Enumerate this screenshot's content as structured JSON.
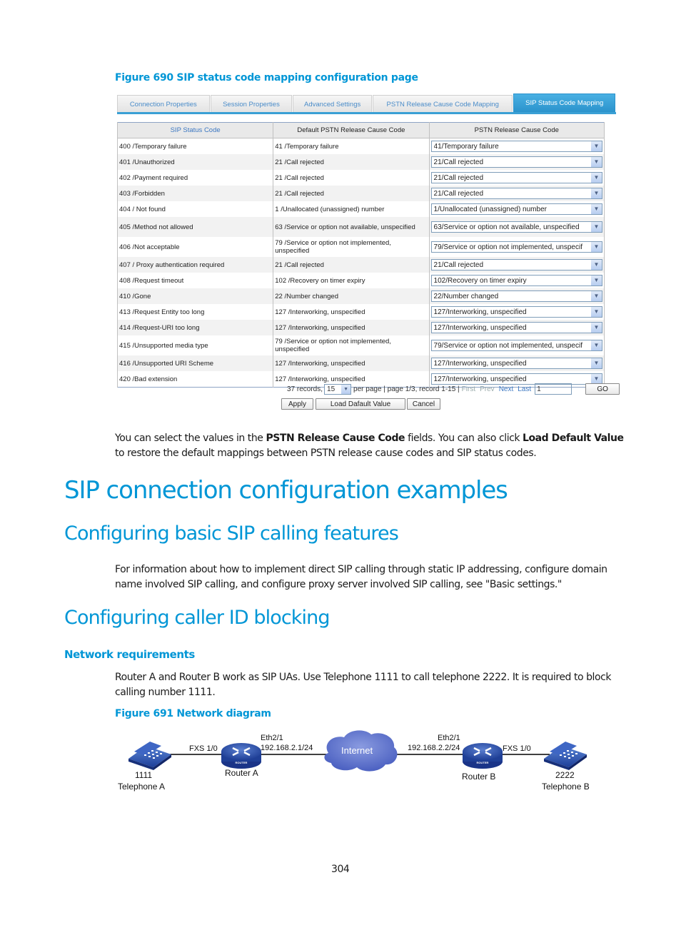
{
  "figure690": {
    "caption": "Figure 690 SIP status code mapping configuration page",
    "tabs": [
      {
        "label": "Connection Properties",
        "active": false
      },
      {
        "label": "Session Properties",
        "active": false
      },
      {
        "label": "Advanced Settings",
        "active": false
      },
      {
        "label": "PSTN Release Cause Code Mapping",
        "active": false
      },
      {
        "label": "SIP Status Code Mapping",
        "active": true
      }
    ],
    "table": {
      "headers": [
        "SIP Status Code",
        "Default PSTN Release Cause Code",
        "PSTN Release Cause Code"
      ],
      "rows": [
        {
          "sip": "400 /Temporary failure",
          "default": "41 /Temporary failure",
          "selected": "41/Temporary failure"
        },
        {
          "sip": "401 /Unauthorized",
          "default": "21 /Call rejected",
          "selected": "21/Call rejected"
        },
        {
          "sip": "402 /Payment required",
          "default": "21 /Call rejected",
          "selected": "21/Call rejected"
        },
        {
          "sip": "403 /Forbidden",
          "default": "21 /Call rejected",
          "selected": "21/Call rejected"
        },
        {
          "sip": "404 / Not found",
          "default": "1 /Unallocated (unassigned) number",
          "selected": "1/Unallocated (unassigned) number"
        },
        {
          "sip": "405 /Method not allowed",
          "default": "63 /Service or option not available, unspecified",
          "selected": "63/Service or option not available, unspecified"
        },
        {
          "sip": "406 /Not acceptable",
          "default": "79 /Service or option not implemented, unspecified",
          "selected": "79/Service or option not implemented, unspecif"
        },
        {
          "sip": "407 / Proxy authentication required",
          "default": "21 /Call rejected",
          "selected": "21/Call rejected"
        },
        {
          "sip": "408 /Request timeout",
          "default": "102 /Recovery on timer expiry",
          "selected": "102/Recovery on timer expiry"
        },
        {
          "sip": "410 /Gone",
          "default": "22 /Number changed",
          "selected": "22/Number changed"
        },
        {
          "sip": "413 /Request Entity too long",
          "default": "127 /Interworking, unspecified",
          "selected": "127/Interworking, unspecified"
        },
        {
          "sip": "414 /Request-URI too long",
          "default": "127 /Interworking, unspecified",
          "selected": "127/Interworking, unspecified"
        },
        {
          "sip": "415 /Unsupported media type",
          "default": "79 /Service or option not implemented, unspecified",
          "selected": "79/Service or option not implemented, unspecif"
        },
        {
          "sip": "416 /Unsupported URI Scheme",
          "default": "127 /Interworking, unspecified",
          "selected": "127/Interworking, unspecified"
        },
        {
          "sip": "420 /Bad extension",
          "default": "127 /Interworking, unspecified",
          "selected": "127/Interworking, unspecified"
        }
      ]
    },
    "pager": {
      "records": "37 records,",
      "per_page_value": "15",
      "per_page_text": "per page | page 1/3, record 1-15 |",
      "first": "First",
      "prev": "Prev",
      "next": "Next",
      "last": "Last",
      "page_input": "1",
      "go": "GO"
    },
    "buttons": {
      "apply": "Apply",
      "load_default": "Load Dafault Value",
      "cancel": "Cancel"
    }
  },
  "para1": {
    "t1": "You can select the values in the ",
    "b1": "PSTN Release Cause Code",
    "t2": " fields. You can also click ",
    "b2": "Load Default Value",
    "t3": " to restore the default mappings between PSTN release cause codes and SIP status codes."
  },
  "heading_main": "SIP connection configuration examples",
  "heading_basic": "Configuring basic SIP calling features",
  "para_basic": "For information about how to implement direct SIP calling through static IP addressing, configure domain name involved SIP calling, and configure proxy server involved SIP calling, see \"Basic settings.\"",
  "heading_callerid": "Configuring caller ID blocking",
  "heading_netreq": "Network requirements",
  "para_netreq": "Router A and Router B work as SIP UAs. Use Telephone 1111 to call telephone 2222. It is required to block calling number 1111.",
  "figure691": {
    "caption": "Figure 691 Network diagram",
    "phone_a": {
      "number": "1111",
      "name": "Telephone A",
      "icon": "telephone-icon"
    },
    "router_a": {
      "name": "Router A",
      "port_fxs": "FXS 1/0",
      "port_eth": "Eth2/1",
      "ip": "192.168.2.1/24",
      "icon": "router-icon",
      "badge": "ROUTER"
    },
    "internet": {
      "label": "Internet",
      "icon": "cloud-icon"
    },
    "router_b": {
      "name": "Router B",
      "port_fxs": "FXS 1/0",
      "port_eth": "Eth2/1",
      "ip": "192.168.2.2/24",
      "icon": "router-icon",
      "badge": "ROUTER"
    },
    "phone_b": {
      "number": "2222",
      "name": "Telephone B",
      "icon": "telephone-icon"
    }
  },
  "page_number": "304"
}
